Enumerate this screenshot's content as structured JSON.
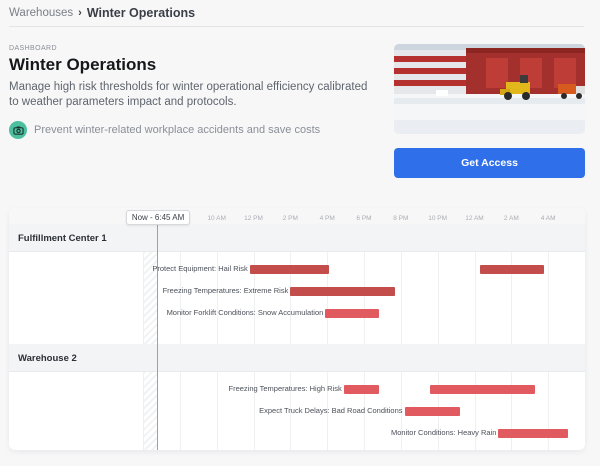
{
  "breadcrumb": {
    "parent": "Warehouses",
    "separator": "›",
    "current": "Winter Operations"
  },
  "header": {
    "eyebrow": "DASHBOARD",
    "title": "Winter Operations",
    "description": "Manage high risk thresholds for winter operational efficiency calibrated to weather parameters impact and protocols.",
    "feature": {
      "icon": "camera-icon",
      "text": "Prevent winter-related workplace accidents and save costs"
    }
  },
  "cta": {
    "label": "Get Access"
  },
  "colors": {
    "accent": "#2f6fea",
    "feature_icon": "#4dbf9f",
    "bar_dark": "#c24d4a",
    "bar_light": "#e15a5f"
  },
  "timeline": {
    "now_label": "Now - 6:45 AM",
    "now_value": 6.75,
    "start": 6,
    "end": 30,
    "ticks": [
      {
        "label": "6 AM",
        "value": 6
      },
      {
        "label": "8 AM",
        "value": 8
      },
      {
        "label": "10 AM",
        "value": 10
      },
      {
        "label": "12 PM",
        "value": 12
      },
      {
        "label": "2 PM",
        "value": 14
      },
      {
        "label": "4 PM",
        "value": 16
      },
      {
        "label": "6 PM",
        "value": 18
      },
      {
        "label": "8 PM",
        "value": 20
      },
      {
        "label": "10 PM",
        "value": 22
      },
      {
        "label": "12 AM",
        "value": 24
      },
      {
        "label": "2 AM",
        "value": 26
      },
      {
        "label": "4 AM",
        "value": 28
      }
    ],
    "groups": [
      {
        "name": "Fulfillment Center 1",
        "tasks": [
          {
            "label": "Protect Equipment: Hail Risk",
            "bars": [
              {
                "start": 11.8,
                "end": 16.1,
                "tone": "dark"
              },
              {
                "start": 24.3,
                "end": 27.8,
                "tone": "dark"
              }
            ]
          },
          {
            "label": "Freezing Temperatures: Extreme Risk",
            "bars": [
              {
                "start": 14.0,
                "end": 19.7,
                "tone": "dark"
              }
            ]
          },
          {
            "label": "Monitor Forklift Conditions: Snow Accumulation",
            "bars": [
              {
                "start": 15.9,
                "end": 18.8,
                "tone": "light"
              }
            ]
          }
        ]
      },
      {
        "name": "Warehouse 2",
        "tasks": [
          {
            "label": "Freezing Temperatures: High Risk",
            "bars": [
              {
                "start": 16.9,
                "end": 18.8,
                "tone": "light"
              },
              {
                "start": 21.6,
                "end": 27.3,
                "tone": "light"
              }
            ]
          },
          {
            "label": "Expect Truck Delays: Bad Road Conditions",
            "bars": [
              {
                "start": 20.2,
                "end": 23.2,
                "tone": "light"
              }
            ]
          },
          {
            "label": "Monitor Conditions: Heavy Rain",
            "bars": [
              {
                "start": 25.3,
                "end": 29.1,
                "tone": "light"
              }
            ]
          }
        ]
      }
    ]
  }
}
